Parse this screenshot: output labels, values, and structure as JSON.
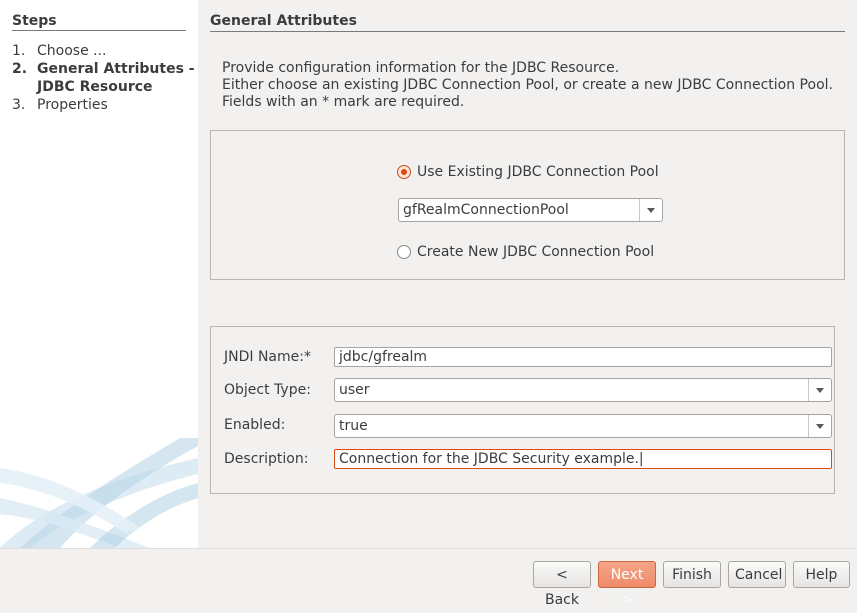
{
  "steps": {
    "title": "Steps",
    "items": [
      {
        "num": "1.",
        "label": "Choose ..."
      },
      {
        "num": "2.",
        "label": "General Attributes -",
        "label_cont": "JDBC Resource"
      },
      {
        "num": "3.",
        "label": "Properties"
      }
    ],
    "active_index": 1
  },
  "main": {
    "title": "General Attributes",
    "intro": [
      "Provide configuration information for the JDBC Resource.",
      "Either choose an existing JDBC Connection Pool, or create a new JDBC Connection Pool.",
      "Fields with an * mark are required."
    ]
  },
  "pool": {
    "use_existing_label": "Use Existing JDBC Connection Pool",
    "use_existing_checked": true,
    "selected_pool": "gfRealmConnectionPool",
    "create_new_label": "Create New JDBC Connection Pool",
    "create_new_checked": false
  },
  "fields": {
    "jndi_label": "JNDI Name:*",
    "jndi_value": "jdbc/gfrealm",
    "object_type_label": "Object Type:",
    "object_type_value": "user",
    "enabled_label": "Enabled:",
    "enabled_value": "true",
    "description_label": "Description:",
    "description_value": "Connection for the JDBC Security example.|"
  },
  "buttons": {
    "back": "< Back",
    "next": "Next >",
    "finish": "Finish",
    "cancel": "Cancel",
    "help": "Help"
  },
  "colors": {
    "accent": "#dd4814",
    "primary_button": "#ef8a68",
    "window_bg": "#f2f1f0"
  }
}
